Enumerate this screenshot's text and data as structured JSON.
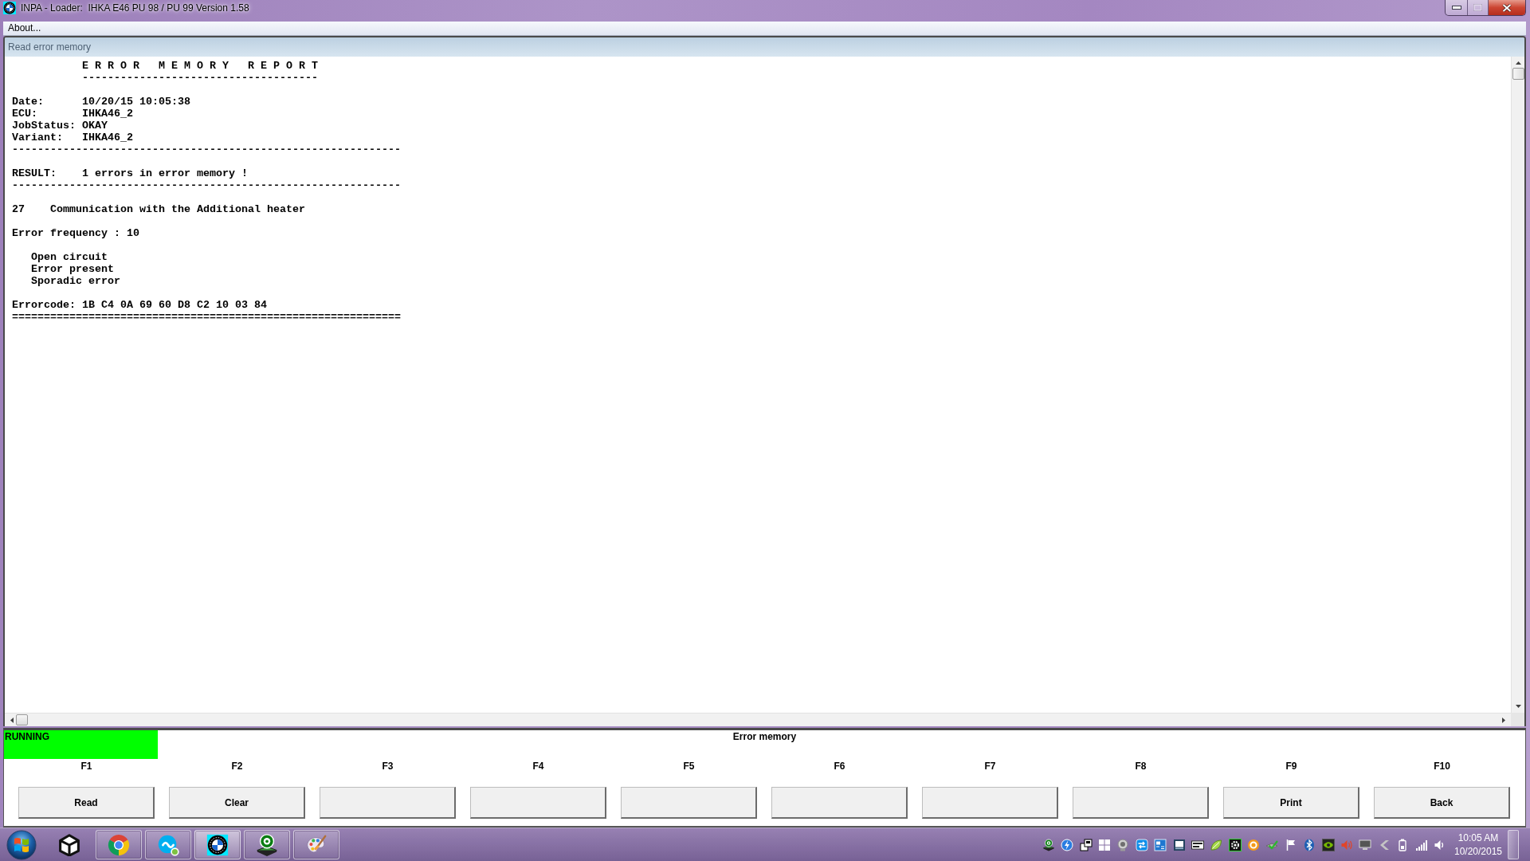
{
  "window": {
    "title": "INPA - Loader:  IHKA E46 PU 98 / PU 99 Version 1.58",
    "controls": [
      {
        "kind": "minimize",
        "disabled": false
      },
      {
        "kind": "maximize",
        "disabled": true
      },
      {
        "kind": "close",
        "disabled": false
      }
    ]
  },
  "menu": [
    "About..."
  ],
  "child_window": {
    "title": "Read error memory"
  },
  "report": {
    "heading": "E R R O R   M E M O R Y   R E P O R T",
    "heading_rule": "-------------------------------------",
    "details": [
      {
        "label": "Date:",
        "value": "10/20/15 10:05:38"
      },
      {
        "label": "ECU:",
        "value": "IHKA46_2"
      },
      {
        "label": "JobStatus:",
        "value": "OKAY"
      },
      {
        "label": "Variant:",
        "value": "IHKA46_2"
      }
    ],
    "details_rule": "-------------------------------------------------------------",
    "result": {
      "label": "RESULT:",
      "value": "1 errors in error memory !"
    },
    "result_rule": "-------------------------------------------------------------",
    "errors": [
      {
        "number": "27",
        "description": "Communication with the Additional heater",
        "frequency": "Error frequency : 10",
        "conditions": [
          "Open circuit",
          "Error present",
          "Sporadic error"
        ],
        "errorcode": "Errorcode: 1B C4 0A 69 60 D8 C2 10 03 84"
      }
    ],
    "end_rule": "============================================================="
  },
  "status": {
    "state": "RUNNING",
    "caption": "Error memory"
  },
  "function_keys": [
    {
      "key": "F1",
      "label": "Read"
    },
    {
      "key": "F2",
      "label": "Clear"
    },
    {
      "key": "F3"
    },
    {
      "key": "F4"
    },
    {
      "key": "F5"
    },
    {
      "key": "F6"
    },
    {
      "key": "F7"
    },
    {
      "key": "F8"
    },
    {
      "key": "F9",
      "label": "Print"
    },
    {
      "key": "F10",
      "label": "Back"
    }
  ],
  "taskbar": {
    "apps": [
      {
        "running": false,
        "selected": false
      },
      {
        "running": true,
        "selected": false
      },
      {
        "running": true,
        "selected": false
      },
      {
        "running": true,
        "selected": true
      },
      {
        "running": true,
        "selected": false
      },
      {
        "running": true,
        "selected": false
      }
    ],
    "clock": {
      "time": "10:05 AM",
      "date": "10/20/2015"
    }
  }
}
